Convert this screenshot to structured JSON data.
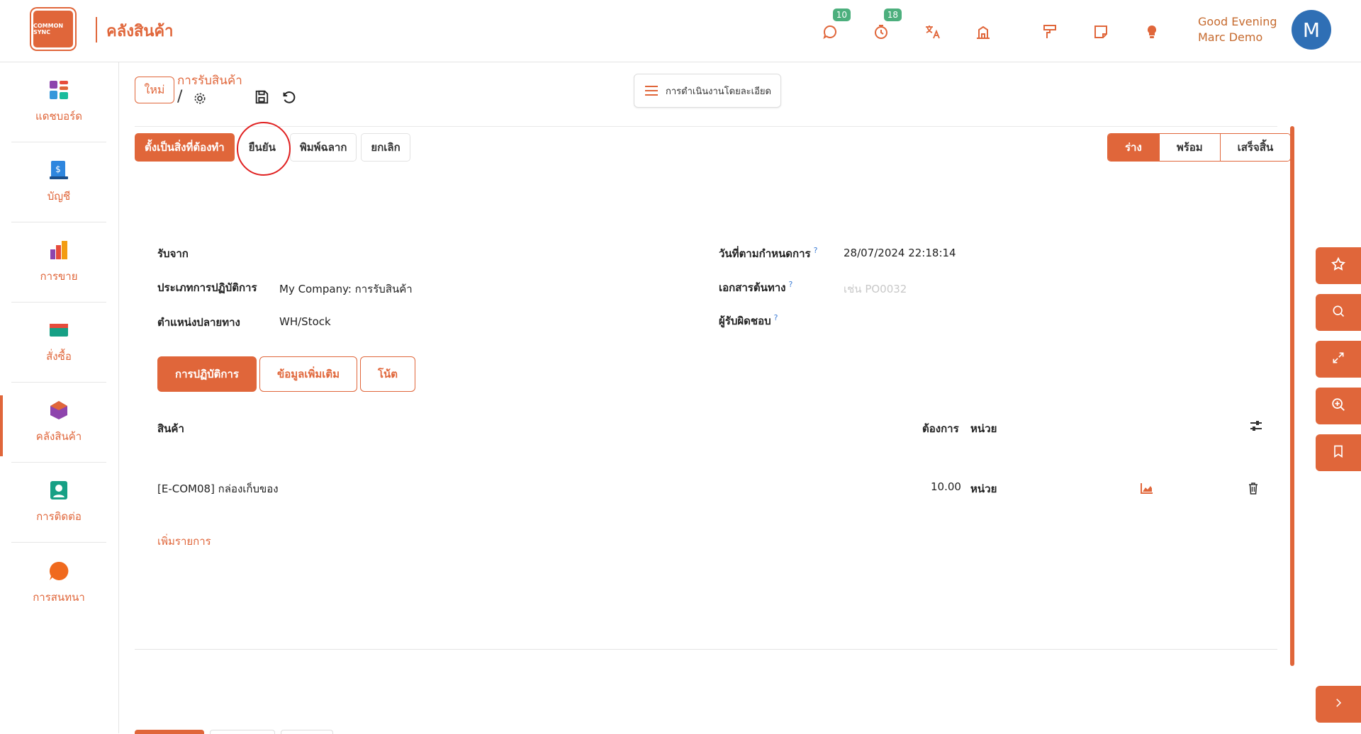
{
  "app": {
    "title": "คลังสินค้า",
    "logo_text": "COMMON SYNC"
  },
  "header": {
    "messages_badge": "10",
    "activities_badge": "18",
    "greeting_line1": "Good Evening",
    "greeting_line2": "Marc Demo",
    "avatar_initial": "M"
  },
  "sidebar": {
    "items": [
      {
        "label": "แดชบอร์ด",
        "icon": "dashboard-icon"
      },
      {
        "label": "บัญชี",
        "icon": "accounting-icon"
      },
      {
        "label": "การขาย",
        "icon": "sales-icon"
      },
      {
        "label": "สั่งซื้อ",
        "icon": "purchase-icon"
      },
      {
        "label": "คลังสินค้า",
        "icon": "inventory-icon",
        "active": true
      },
      {
        "label": "การติดต่อ",
        "icon": "contacts-icon"
      },
      {
        "label": "การสนทนา",
        "icon": "discuss-icon"
      }
    ]
  },
  "control_panel": {
    "new_label": "ใหม่",
    "breadcrumb_title": "การรับสินค้า",
    "breadcrumb_sep": "/",
    "detail_ops_label": "การดำเนินงานโดยละเอียด"
  },
  "actions": {
    "mark_todo": "ตั้งเป็นสิ่งที่ต้องทำ",
    "confirm": "ยืนยัน",
    "print_labels": "พิมพ์ฉลาก",
    "cancel": "ยกเลิก"
  },
  "statusbar": {
    "draft": "ร่าง",
    "ready": "พร้อม",
    "done": "เสร็จสิ้น"
  },
  "form": {
    "receive_from_label": "รับจาก",
    "op_type_label": "ประเภทการปฏิบัติการ",
    "op_type_value": "My Company: การรับสินค้า",
    "dest_location_label": "ตำแหน่งปลายทาง",
    "dest_location_value": "WH/Stock",
    "scheduled_date_label": "วันที่ตามกำหนดการ",
    "scheduled_date_value": "28/07/2024 22:18:14",
    "source_doc_label": "เอกสารต้นทาง",
    "source_doc_placeholder": "เช่น PO0032",
    "responsible_label": "ผู้รับผิดชอบ",
    "help_mark": "?"
  },
  "tabs": {
    "operations": "การปฏิบัติการ",
    "additional_info": "ข้อมูลเพิ่มเติม",
    "note": "โน้ต"
  },
  "table": {
    "headers": {
      "product": "สินค้า",
      "demand": "ต้องการ",
      "unit": "หน่วย"
    },
    "rows": [
      {
        "product": "[E-COM08] กล่องเก็บของ",
        "demand": "10.00",
        "unit": "หน่วย"
      }
    ],
    "add_line": "เพิ่มรายการ"
  },
  "colors": {
    "accent": "#e0663a",
    "badge": "#4caf7d",
    "avatar": "#2f6fb5",
    "highlight_circle": "#e02020"
  }
}
